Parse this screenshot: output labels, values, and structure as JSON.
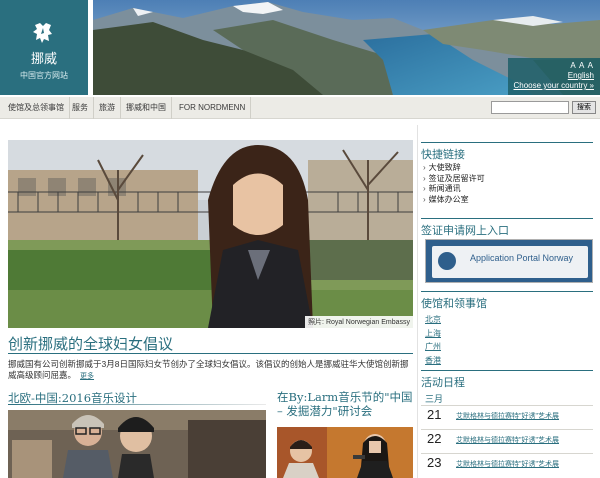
{
  "header": {
    "logo_name": "挪威",
    "logo_subtitle": "中国官方网站",
    "font_sizes": "A A A",
    "english_link": "English",
    "country_link": "Choose your country »"
  },
  "nav": {
    "items": [
      "使馆及总领事馆",
      "服务",
      "旅游",
      "挪威和中国",
      "FOR NORDMENN"
    ],
    "search_placeholder": "",
    "search_button": "搜索"
  },
  "hero": {
    "photo_credit": "照片: Royal Norwegian Embassy",
    "title": "创新挪威的全球妇女倡议",
    "text": "挪威国有公司创新挪威于3月8日国际妇女节创办了全球妇女倡议。该倡议的创始人是挪威驻华大使馆创新挪威高级顾问屈嘉。",
    "more": "更多"
  },
  "stories": [
    {
      "title": "北欧-中国:2016音乐设计"
    },
    {
      "title": "在By:Larm音乐节的\"中国 – 发掘潜力\"研讨会"
    }
  ],
  "sidebar": {
    "quick_links_title": "快捷链接",
    "quick_links": [
      "大使致辞",
      "签证及居留许可",
      "新闻通讯",
      "媒体办公室"
    ],
    "visa_title": "签证申请网上入口",
    "visa_box_text": "Application Portal Norway",
    "consulates_title": "使馆和领事馆",
    "consulates": [
      "北京",
      "上海",
      "广州",
      "香港"
    ],
    "events_title": "活动日程",
    "month": "三月",
    "events": [
      {
        "day": "21",
        "label": "艾默格林与德拉赛特\"好诱\"艺术展"
      },
      {
        "day": "22",
        "label": "艾默格林与德拉赛特\"好诱\"艺术展"
      },
      {
        "day": "23",
        "label": "艾默格林与德拉赛特\"好诱\"艺术展"
      }
    ]
  },
  "colors": {
    "brand": "#2a6f7f",
    "nav_bg": "#ecebe6",
    "visa_blue": "#2f5f8c"
  }
}
